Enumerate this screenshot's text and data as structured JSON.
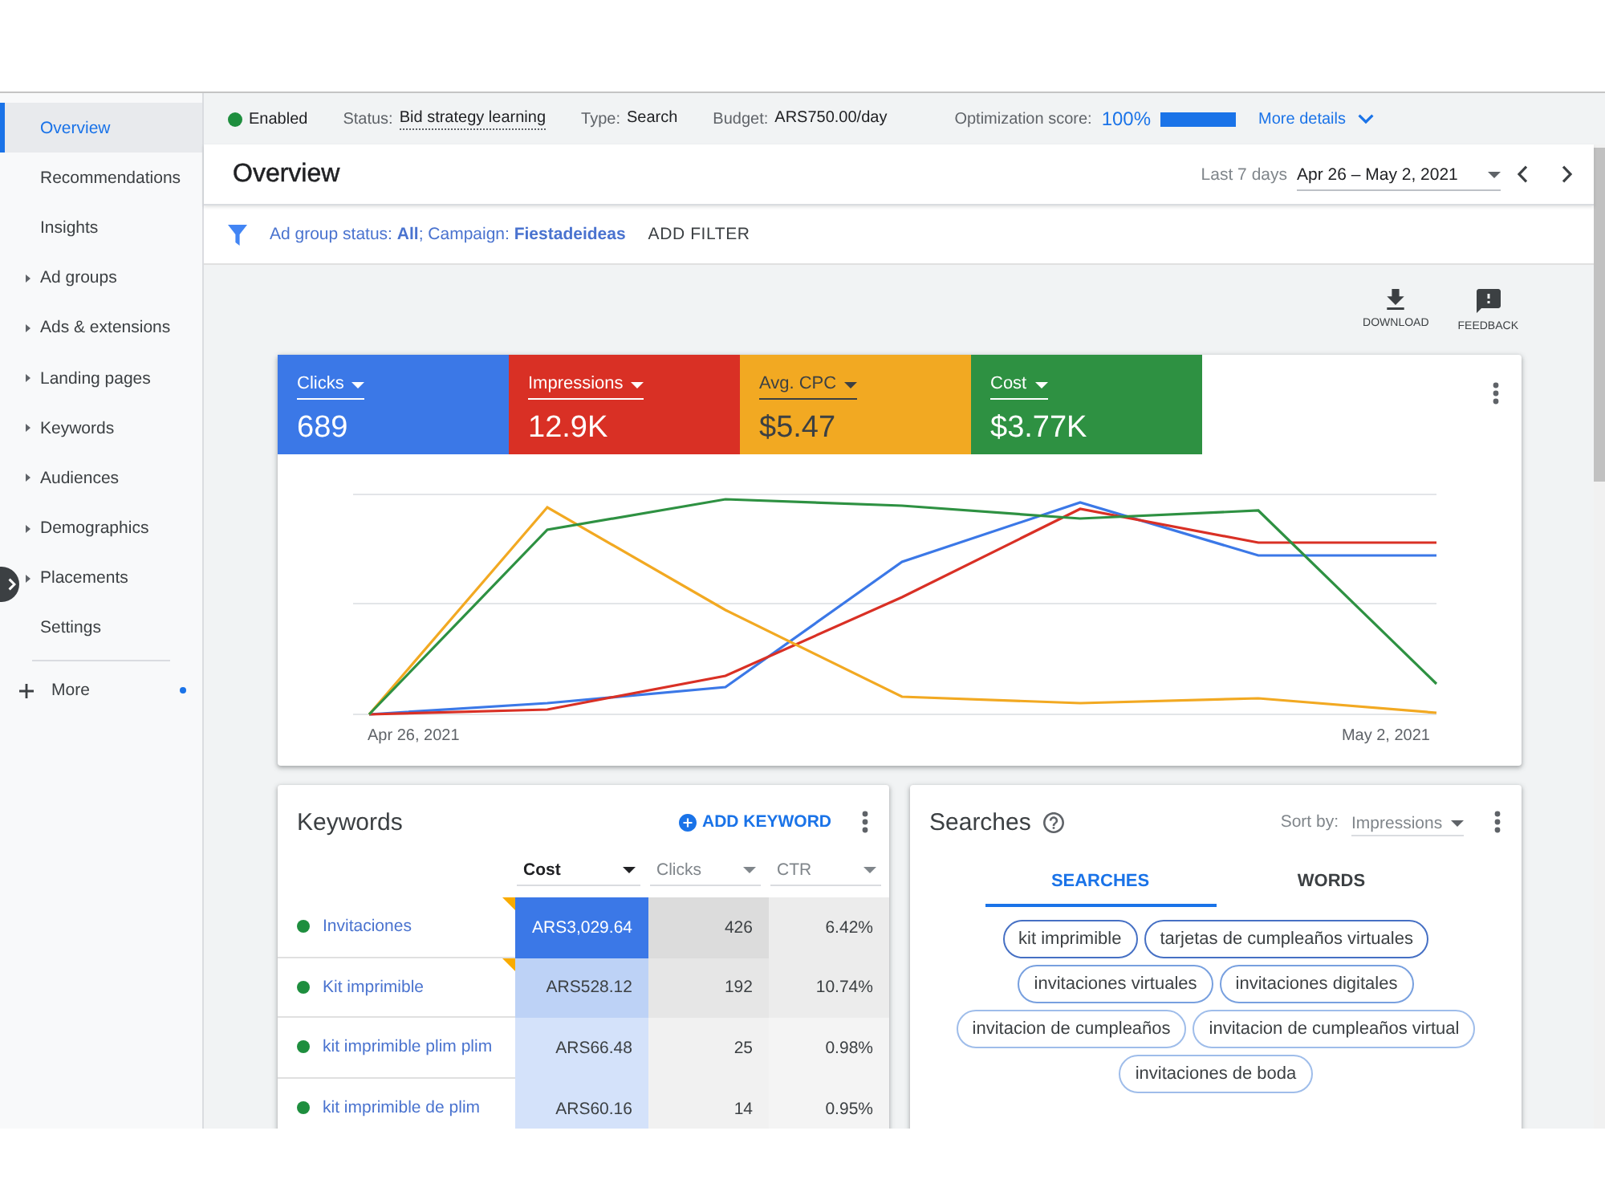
{
  "sidebar": {
    "items": [
      {
        "label": "Overview",
        "selected": true,
        "expandable": false
      },
      {
        "label": "Recommendations",
        "selected": false,
        "expandable": false
      },
      {
        "label": "Insights",
        "selected": false,
        "expandable": false
      },
      {
        "label": "Ad groups",
        "selected": false,
        "expandable": true
      },
      {
        "label": "Ads & extensions",
        "selected": false,
        "expandable": true
      },
      {
        "label": "Landing pages",
        "selected": false,
        "expandable": true
      },
      {
        "label": "Keywords",
        "selected": false,
        "expandable": true
      },
      {
        "label": "Audiences",
        "selected": false,
        "expandable": true
      },
      {
        "label": "Demographics",
        "selected": false,
        "expandable": true
      },
      {
        "label": "Placements",
        "selected": false,
        "expandable": true
      },
      {
        "label": "Settings",
        "selected": false,
        "expandable": false
      }
    ],
    "more": {
      "label": "More",
      "has_update": true
    }
  },
  "status_bar": {
    "campaign_status": {
      "label": "Enabled",
      "enabled": true
    },
    "fields": [
      {
        "label": "Status:",
        "value": "Bid strategy learning",
        "underlined": true
      },
      {
        "label": "Type:",
        "value": "Search",
        "underlined": false
      },
      {
        "label": "Budget:",
        "value": "ARS750.00/day",
        "underlined": false
      }
    ],
    "optimization": {
      "label": "Optimization score:",
      "value": "100%",
      "level": 1
    },
    "more_details": "More details"
  },
  "header": {
    "title": "Overview",
    "range_label": "Last 7 days",
    "date_range": "Apr 26 – May 2, 2021"
  },
  "filter_bar": {
    "filter": "Ad group status: **All**; Campaign: **Fiestadeideas**",
    "add_filter": "ADD FILTER"
  },
  "actions": [
    {
      "kind": "download",
      "label": "DOWNLOAD"
    },
    {
      "kind": "feedback",
      "label": "FEEDBACK"
    }
  ],
  "chart": {
    "metrics": [
      {
        "label": "Clicks",
        "value": "689",
        "color": "#3b78e7"
      },
      {
        "label": "Impressions",
        "value": "12.9K",
        "color": "#d93025"
      },
      {
        "label": "Avg. CPC",
        "value": "$5.47",
        "color": "#f2a922"
      },
      {
        "label": "Cost",
        "value": "$3.77K",
        "color": "#2e9142"
      }
    ],
    "axis_labels": [
      "Apr 26, 2021",
      "May 2, 2021"
    ]
  },
  "keywords": {
    "title": "Keywords",
    "add_label": "ADD KEYWORD",
    "columns": [
      {
        "label": "Cost",
        "selected": true
      },
      {
        "label": "Clicks",
        "selected": false
      },
      {
        "label": "CTR",
        "selected": false
      }
    ],
    "rows": [
      {
        "keyword": "Invitaciones",
        "enabled": true,
        "flagged": true,
        "cells": [
          {
            "value": "ARS3,029.64",
            "color": "#3b78e7"
          },
          {
            "value": "426",
            "color": "#dcdcdc"
          },
          {
            "value": "6.42%",
            "color": "#ececec"
          }
        ]
      },
      {
        "keyword": "Kit imprimible",
        "enabled": true,
        "flagged": true,
        "cells": [
          {
            "value": "ARS528.12",
            "color": "#bdd2f6"
          },
          {
            "value": "192",
            "color": "#e6e6e6"
          },
          {
            "value": "10.74%",
            "color": "#ececec"
          }
        ]
      },
      {
        "keyword": "kit imprimible plim plim",
        "enabled": true,
        "flagged": false,
        "cells": [
          {
            "value": "ARS66.48",
            "color": "#d4e2fa"
          },
          {
            "value": "25",
            "color": "#f1f1f1"
          },
          {
            "value": "0.98%",
            "color": "#f4f4f4"
          }
        ]
      },
      {
        "keyword": "kit imprimible de plim",
        "enabled": true,
        "flagged": false,
        "cells": [
          {
            "value": "ARS60.16",
            "color": "#d4e2fa"
          },
          {
            "value": "14",
            "color": "#f1f1f1"
          },
          {
            "value": "0.95%",
            "color": "#f4f4f4"
          }
        ]
      }
    ]
  },
  "searches": {
    "title": "Searches",
    "sort_label": "Sort by:",
    "sort_value": "Impressions",
    "tabs": [
      {
        "label": "SEARCHES",
        "selected": true
      },
      {
        "label": "WORDS",
        "selected": false
      }
    ],
    "chips": [
      {
        "text": "kit imprimible",
        "color": "#4670c4"
      },
      {
        "text": "tarjetas de cumpleaños virtuales",
        "color": "#4670c4"
      },
      {
        "text": "invitaciones virtuales",
        "color": "#78a0df"
      },
      {
        "text": "invitaciones digitales",
        "color": "#78a0df"
      },
      {
        "text": "invitacion de cumpleaños",
        "color": "#9fbdea"
      },
      {
        "text": "invitacion de cumpleaños virtual",
        "color": "#9fbdea"
      },
      {
        "text": "invitaciones de boda",
        "color": "#9fbdea"
      }
    ]
  }
}
